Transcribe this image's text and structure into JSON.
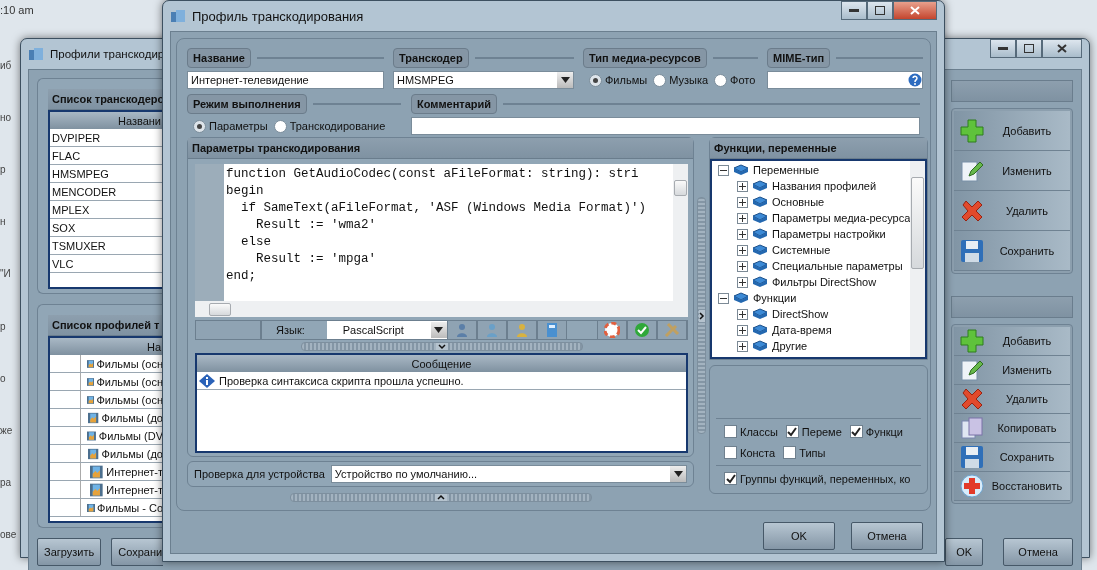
{
  "background_page": {
    "time": ":10 am",
    "fragments": [
      "иб",
      "но",
      "р",
      "н",
      "\"И",
      "р",
      "о",
      "же",
      "ра",
      "ове"
    ]
  },
  "back_window": {
    "title": "Профили транскодир",
    "transcoders": {
      "title": "Список транскодеро",
      "column": "Названи",
      "rows": [
        "DVPIPER",
        "FLAC",
        "HMSMPEG",
        "MENCODER",
        "MPLEX",
        "SOX",
        "TSMUXER",
        "VLC"
      ]
    },
    "profiles": {
      "title": "Список профилей т",
      "column": "На",
      "rows": [
        "Фильмы (осн",
        "Фильмы (осн",
        "Фильмы (осн",
        "Фильмы (до",
        "Фильмы (DV",
        "Фильмы (до",
        "Интернет-т",
        "Интернет-т",
        "Фильмы - Со"
      ]
    },
    "left_buttons": [
      "Загрузить",
      "Сохрани"
    ],
    "top_actions": [
      {
        "kind": "add",
        "label": "Добавить"
      },
      {
        "kind": "edit",
        "label": "Изменить"
      },
      {
        "kind": "delete",
        "label": "Удалить"
      },
      {
        "kind": "save",
        "label": "Сохранить"
      }
    ],
    "bottom_actions": [
      {
        "kind": "add",
        "label": "Добавить"
      },
      {
        "kind": "edit",
        "label": "Изменить"
      },
      {
        "kind": "delete",
        "label": "Удалить"
      },
      {
        "kind": "copy",
        "label": "Копировать"
      },
      {
        "kind": "save",
        "label": "Сохранить"
      },
      {
        "kind": "restore",
        "label": "Восстановить"
      }
    ],
    "dialog_buttons": [
      "OK",
      "Отмена"
    ]
  },
  "dialog": {
    "title": "Профиль транскодирования",
    "name": {
      "label": "Название",
      "value": "Интернет-телевидение"
    },
    "transcoder": {
      "label": "Транскодер",
      "value": "HMSMPEG"
    },
    "media_type": {
      "label": "Тип медиа-ресурсов",
      "options": [
        {
          "label": "Фильмы",
          "selected": true
        },
        {
          "label": "Музыка",
          "selected": false
        },
        {
          "label": "Фото",
          "selected": false
        }
      ]
    },
    "mime": {
      "label": "MIME-тип"
    },
    "mode": {
      "label": "Режим выполнения",
      "options": [
        {
          "label": "Параметры",
          "selected": true
        },
        {
          "label": "Транскодирование",
          "selected": false
        }
      ]
    },
    "comment": {
      "label": "Комментарий"
    },
    "params": {
      "title": "Параметры транскодирования",
      "code": [
        "function GetAudioCodec(const aFileFormat: string): stri",
        "begin",
        "  if SameText(aFileFormat, 'ASF (Windows Media Format)')",
        "    Result := 'wma2'",
        "  else",
        "    Result := 'mpga'",
        "end;"
      ],
      "language_label": "Язык:",
      "language": "PascalScript",
      "messages": {
        "column": "Сообщение",
        "rows": [
          "Проверка синтаксиса скрипта прошла успешно."
        ]
      },
      "device_label": "Проверка для устройства",
      "device": "Устройство по умолчанию..."
    },
    "functions": {
      "title": "Функции, переменные",
      "tree": [
        {
          "label": "Переменные",
          "expanded": true,
          "children": [
            {
              "label": "Названия профилей",
              "expanded": false
            },
            {
              "label": "Основные",
              "expanded": false
            },
            {
              "label": "Параметры медиа-ресурса",
              "expanded": false
            },
            {
              "label": "Параметры настройки",
              "expanded": false
            },
            {
              "label": "Системные",
              "expanded": false
            },
            {
              "label": "Специальные параметры",
              "expanded": false
            },
            {
              "label": "Фильтры DirectShow",
              "expanded": false
            }
          ]
        },
        {
          "label": "Функции",
          "expanded": true,
          "children": [
            {
              "label": "DirectShow",
              "expanded": false
            },
            {
              "label": "Дата-время",
              "expanded": false
            },
            {
              "label": "Другие",
              "expanded": false
            }
          ]
        }
      ],
      "filters": [
        {
          "label": "Классы",
          "checked": false
        },
        {
          "label": "Переме",
          "checked": true
        },
        {
          "label": "Функци",
          "checked": true
        },
        {
          "label": "Конста",
          "checked": false
        },
        {
          "label": "Типы",
          "checked": false
        }
      ],
      "groups": {
        "label": "Группы функций, переменных, ко",
        "checked": true
      }
    },
    "buttons": [
      "OK",
      "Отмена"
    ]
  }
}
